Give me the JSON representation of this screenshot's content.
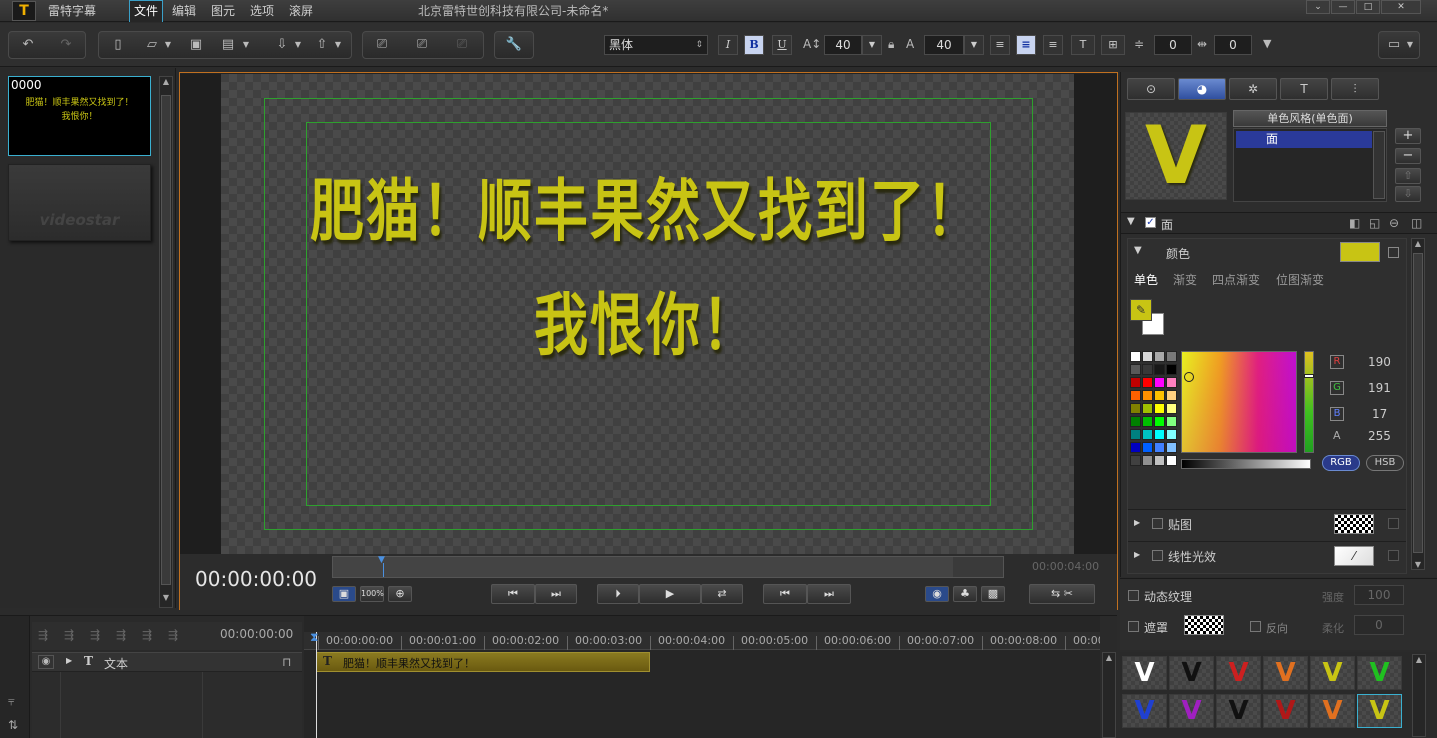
{
  "app": {
    "logo": "T",
    "name": "雷特字幕",
    "title": "北京雷特世创科技有限公司-未命名*"
  },
  "menu": [
    "文件",
    "编辑",
    "图元",
    "选项",
    "滚屏"
  ],
  "toolbar": {
    "font_name": "黑体",
    "italic": "I",
    "bold": "B",
    "underline": "U",
    "font_size": "40",
    "font_size2": "40",
    "spacing1": "0",
    "spacing2": "0"
  },
  "thumbnails": [
    {
      "id": "0000",
      "line1": "肥猫！顺丰果然又找到了！",
      "line2": "我恨你！"
    },
    {
      "watermark": "videostar"
    }
  ],
  "canvas": {
    "line1": "肥猫！顺丰果然又找到了！",
    "line2": "我恨你！"
  },
  "playback": {
    "timecode": "00:00:00:00",
    "end_time": "00:00:04:00",
    "zoom": "100%"
  },
  "right_panel": {
    "style_select": "单色风格(单色面)",
    "layer_item": "面",
    "section_face": "面",
    "color_label": "颜色",
    "color_tabs": [
      "单色",
      "渐变",
      "四点渐变",
      "位图渐变"
    ],
    "rgb": {
      "R": "190",
      "G": "191",
      "B": "17",
      "A": "255"
    },
    "rgb_labels": {
      "R": "R",
      "G": "G",
      "B": "B",
      "A": "A"
    },
    "mode_rgb": "RGB",
    "mode_hsb": "HSB",
    "texture_label": "贴图",
    "linear_gloss_label": "线性光效",
    "dynamic_texture": "动态纹理",
    "strength_label": "强度",
    "strength_value": "100",
    "mask_label": "遮罩",
    "reverse_label": "反向",
    "soften_label": "柔化",
    "soften_value": "0",
    "accent_color": "#c8c414"
  },
  "timeline": {
    "timecode": "00:00:00:00",
    "ruler": [
      "00:00:00:00",
      "00:00:01:00",
      "00:00:02:00",
      "00:00:03:00",
      "00:00:04:00",
      "00:00:05:00",
      "00:00:06:00",
      "00:00:07:00",
      "00:00:08:00",
      "00:00"
    ],
    "track_label": "文本",
    "clip_text": "肥猫！顺丰果然又找到了！"
  },
  "style_swatches": [
    {
      "letter": "V",
      "color": "#ffffff"
    },
    {
      "letter": "V",
      "color": "#111111"
    },
    {
      "letter": "V",
      "color": "#cc2020"
    },
    {
      "letter": "V",
      "color": "#e07020"
    },
    {
      "letter": "V",
      "color": "#c8c414"
    },
    {
      "letter": "V",
      "color": "#20c020"
    },
    {
      "letter": "V",
      "color": "#2040d0"
    },
    {
      "letter": "V",
      "color": "#a020c0"
    },
    {
      "letter": "V",
      "color": "#111111"
    },
    {
      "letter": "V",
      "color": "#b01818"
    },
    {
      "letter": "V",
      "color": "#e07020"
    },
    {
      "letter": "V",
      "color": "#c8c414"
    }
  ]
}
